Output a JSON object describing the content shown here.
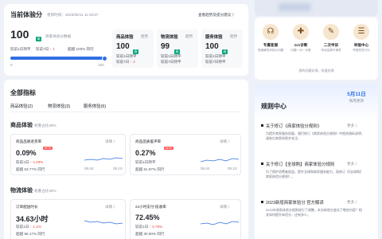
{
  "overview": {
    "title": "当前体验分",
    "updated": "更新时间：2023/05/11 11:26:57",
    "trend_link": "查看趋势及提分建议 〉",
    "score": "100",
    "score_badge": "高",
    "score_note": "商家体验分数据",
    "compare_1": "较前1日持平",
    "compare_7": "较前7日 ↑ 1",
    "compare_pct": "超越 100% 同行",
    "progress_min": "0",
    "progress_max": "100",
    "progress_value": 1.0
  },
  "subscores": [
    {
      "title": "商品体验",
      "trend": "趋势",
      "score": "100",
      "badge": "高",
      "d1": "较前1日持平",
      "d7": "较前7日 ↑ 2"
    },
    {
      "title": "物流体验",
      "trend": "趋势",
      "score": "99",
      "badge": "高",
      "d1": "较前1日持平",
      "d7": "较前7日持平"
    },
    {
      "title": "服务体验",
      "trend": "趋势",
      "score": "100",
      "badge": "高",
      "d1": "较前1日持平",
      "d7": "较前7日持平"
    }
  ],
  "metrics": {
    "title": "全部指标",
    "tabs": [
      "商品体验(2)",
      "物流体验(3)",
      "服务体验(6)"
    ],
    "goods": {
      "title": "商品体验",
      "weight": "权重占比40%",
      "cards": [
        {
          "name": "商品品质退货率",
          "new": "NEW",
          "detail": "详情 〉",
          "value": "0.09%",
          "d1": "较前1日 ↑ 4.49%",
          "rank": "超越 53.77% 同行",
          "dates": [
            "05.04",
            "05.10"
          ]
        },
        {
          "name": "商品品质差评率",
          "new": "NEW",
          "detail": "详情 〉",
          "value": "0.27%",
          "d1": "较前1日持平",
          "rank": "超越 61.97% 同行",
          "dates": [
            "05.04",
            "05.10"
          ]
        }
      ]
    },
    "logistics": {
      "title": "物流体验",
      "weight": "权重占比40%",
      "cards": [
        {
          "name": "订单配送时长",
          "detail": "详情 〉",
          "value": "34.63小时",
          "d1": "较前1日 ↑ 1.1%",
          "rank": "超越 95.17% 同行"
        },
        {
          "name": "24小时支付-揽收率",
          "detail": "详情 〉",
          "value": "72.45%",
          "d1": "较前1日 ↑ 0.75%",
          "rank": "超越 30.90% 同行"
        }
      ]
    }
  },
  "quick_actions": [
    {
      "icon": "headset-icon",
      "glyph": "☊",
      "title": "专属客服",
      "desc": "快速解答体验分问题"
    },
    {
      "icon": "diagnosis-icon",
      "glyph": "✚",
      "title": "1v1诊断",
      "desc": "问题一对一诊断"
    },
    {
      "icon": "study-icon",
      "glyph": "✎",
      "title": "二次申诉",
      "desc": "申诉结果不满意"
    },
    {
      "icon": "report-icon",
      "glyph": "☰",
      "title": "举报中心",
      "desc": "举报恶意行为"
    }
  ],
  "feedback_note": "我的问题反馈，快速处理",
  "rules": {
    "date": "5月11日",
    "date_sub": "每周更新",
    "title": "规则中心",
    "items": [
      {
        "title": "关于修订《商家体验分规则》",
        "more": "更多 〉",
        "desc": "为提升商家服务质量，我们修订《商家体验分规则》中相关指标说明，请各位商家知悉并关注。"
      },
      {
        "title": "关于修订【全球购】商家体验分规则",
        "more": "更多 〉",
        "desc": "为了保护消费者权益，提升全球购商家服务能力，现修订《【全球购】商家体验分规则》。"
      },
      {
        "title": "2023新增商家体验分 官方解读",
        "more": "更多 〉",
        "desc": "2023年商家体验分规则进行了调整，本次体验分变化了哪些内容？相关如何提升体验分，还有多少。"
      }
    ]
  }
}
